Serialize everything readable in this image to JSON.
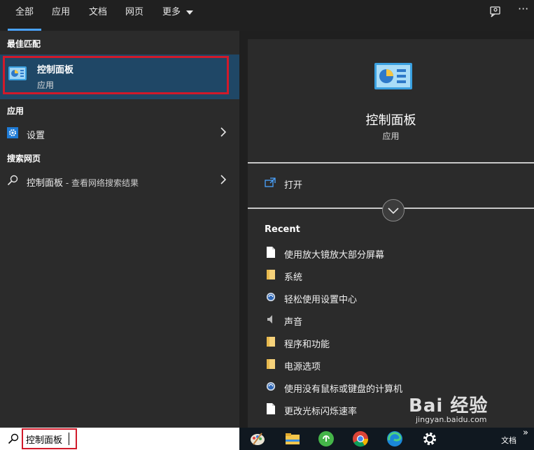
{
  "tabs": [
    "全部",
    "应用",
    "文档",
    "网页",
    "更多"
  ],
  "left": {
    "best_match_header": "最佳匹配",
    "best_match": {
      "title": "控制面板",
      "subtitle": "应用"
    },
    "apps_header": "应用",
    "apps": [
      {
        "label": "设置"
      }
    ],
    "web_header": "搜索网页",
    "web": {
      "query": "控制面板",
      "suffix": " - 查看网络搜索结果"
    }
  },
  "preview": {
    "title": "控制面板",
    "subtitle": "应用",
    "open_label": "打开",
    "recent_header": "Recent",
    "recent": [
      {
        "label": "使用放大镜放大部分屏幕",
        "icon": "document-icon"
      },
      {
        "label": "系统",
        "icon": "folder-icon"
      },
      {
        "label": "轻松使用设置中心",
        "icon": "ease-of-access-icon"
      },
      {
        "label": "声音",
        "icon": "speaker-icon"
      },
      {
        "label": "程序和功能",
        "icon": "folder-icon"
      },
      {
        "label": "电源选项",
        "icon": "folder-icon"
      },
      {
        "label": "使用没有鼠标或键盘的计算机",
        "icon": "ease-of-access-icon"
      },
      {
        "label": "更改光标闪烁速率",
        "icon": "document-icon"
      }
    ]
  },
  "search": {
    "value": "控制面板"
  },
  "taskbar": {
    "docs_label": "文档",
    "overflow": "»"
  },
  "watermark": {
    "main": "Bai 经验",
    "sub": "jingyan.baidu.com"
  },
  "colors": {
    "accent": "#4aa3ff",
    "highlight_border": "#d11a2a",
    "selection": "#1f4766"
  }
}
